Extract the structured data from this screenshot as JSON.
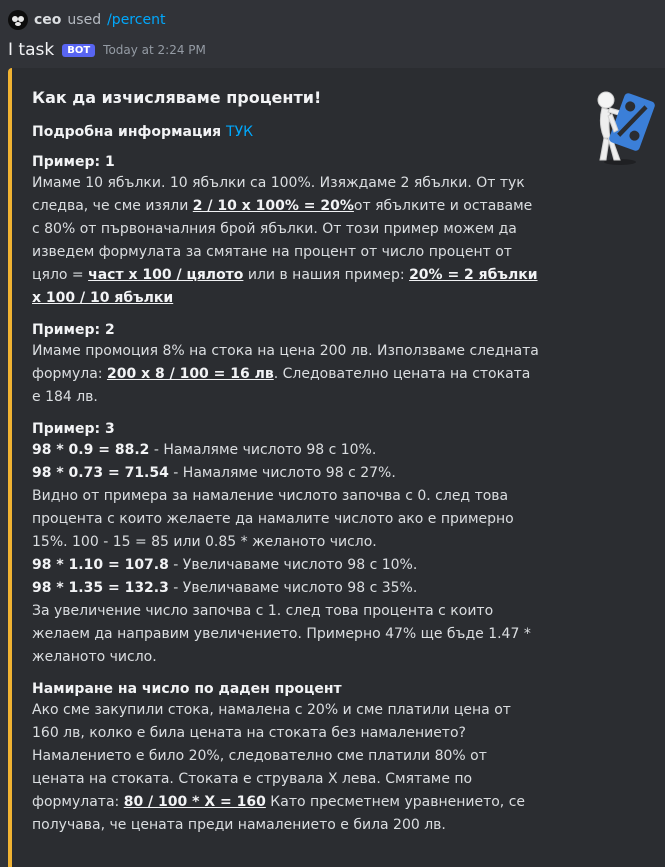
{
  "reply": {
    "username": "ceo",
    "verb": "used",
    "command": "/percent"
  },
  "author": {
    "name": "I task",
    "badge": "BOT",
    "timestamp": "Today at 2:24 PM"
  },
  "embed": {
    "accent_color": "#f0b232",
    "title": "Как да изчисляваме проценти!",
    "thumbnail_icon": "percent-man-icon",
    "info": {
      "label": "Подробна информация",
      "link": "ТУК"
    },
    "ex1": {
      "name": "Пример: 1",
      "t1": "Имаме 10 ябълки. 10 ябълки са 100%. Изяждаме 2 ябълки. От тук следва, че сме изяли ",
      "f1": "2 / 10 x 100% = 20%",
      "t2": "от ябълките и оставаме с 80% от първоначалния брой ябълки. От този пример можем да изведем формулата за смятане на процент от число процент от цяло = ",
      "f2": "част x 100 / цялото",
      "t3": " или в нашия пример: ",
      "f3": "20% = 2 ябълки x 100 / 10 ябълки"
    },
    "ex2": {
      "name": "Пример: 2",
      "t1": "Имаме промоция 8% на стока на цена 200 лв. Използваме следната формула: ",
      "f1": "200 x 8 / 100 = 16 лв",
      "t2": ". Следователно цената на стоката е 184 лв."
    },
    "ex3": {
      "name": "Пример: 3",
      "r1_bold": "98 * 0.9 = 88.2",
      "r1_text": " - Намаляме числото 98 с 10%.",
      "r2_bold": "98 * 0.73 = 71.54",
      "r2_text": " - Намаляме числото 98 с 27%.",
      "p1": "Видно от примера за намаление числото започва с 0. след това процента с които желаете да намалите числото ако е примерно 15%. 100 - 15 = 85 или 0.85 * желаното число.",
      "r3_bold": "98 * 1.10 = 107.8",
      "r3_text": " - Увеличаваме числото 98 с 10%.",
      "r4_bold": "98 * 1.35 = 132.3",
      "r4_text": " - Увеличаваме числото 98 с 35%.",
      "p2": "За увеличение число започва с 1. след това процента с които желаем да направим увеличението. Примерно 47% ще бъде 1.47 * желаното число."
    },
    "ex4": {
      "name": "Намиране на число по даден процент",
      "t1": "Ако сме закупили стока, намалена с 20% и сме платили цена от 160 лв, колко е била цената на стоката без намалението? Намалението е било 20%, следователно сме платили 80% от цената на стоката. Стоката е струвала X лева. Смятаме по формулата: ",
      "f1": "80 / 100 * X = 160",
      "t2": " Като пресметнем уравнението, се получава, че цената преди намалението е била 200 лв."
    }
  }
}
